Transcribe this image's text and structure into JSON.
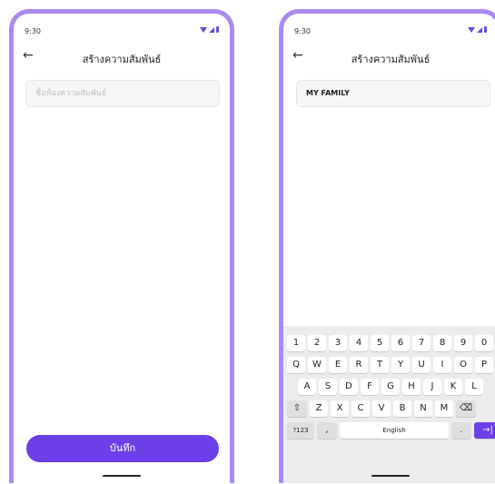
{
  "status": {
    "time": "9:30"
  },
  "screen_left": {
    "title": "สร้างความสัมพันธ์",
    "input_placeholder": "ชื่อห้องความสัมพันธ์",
    "save_label": "บันทึก"
  },
  "screen_right": {
    "title": "สร้างความสัมพันธ์",
    "input_value": "MY FAMILY"
  },
  "keyboard": {
    "row1": [
      "1",
      "2",
      "3",
      "4",
      "5",
      "6",
      "7",
      "8",
      "9",
      "0"
    ],
    "row2": [
      "Q",
      "W",
      "E",
      "R",
      "T",
      "Y",
      "U",
      "I",
      "O",
      "P"
    ],
    "row3": [
      "A",
      "S",
      "D",
      "F",
      "G",
      "H",
      "J",
      "K",
      "L"
    ],
    "row4": [
      "Z",
      "X",
      "C",
      "V",
      "B",
      "N",
      "M"
    ],
    "symbols_label": "?123",
    "comma": ",",
    "space_label": "English",
    "period": "."
  },
  "icons": {
    "back": "arrow-left-icon",
    "shift": "shift-icon",
    "backspace": "backspace-icon",
    "enter": "enter-icon"
  },
  "colors": {
    "accent": "#6c3fe8",
    "frame": "#a98bf0"
  }
}
